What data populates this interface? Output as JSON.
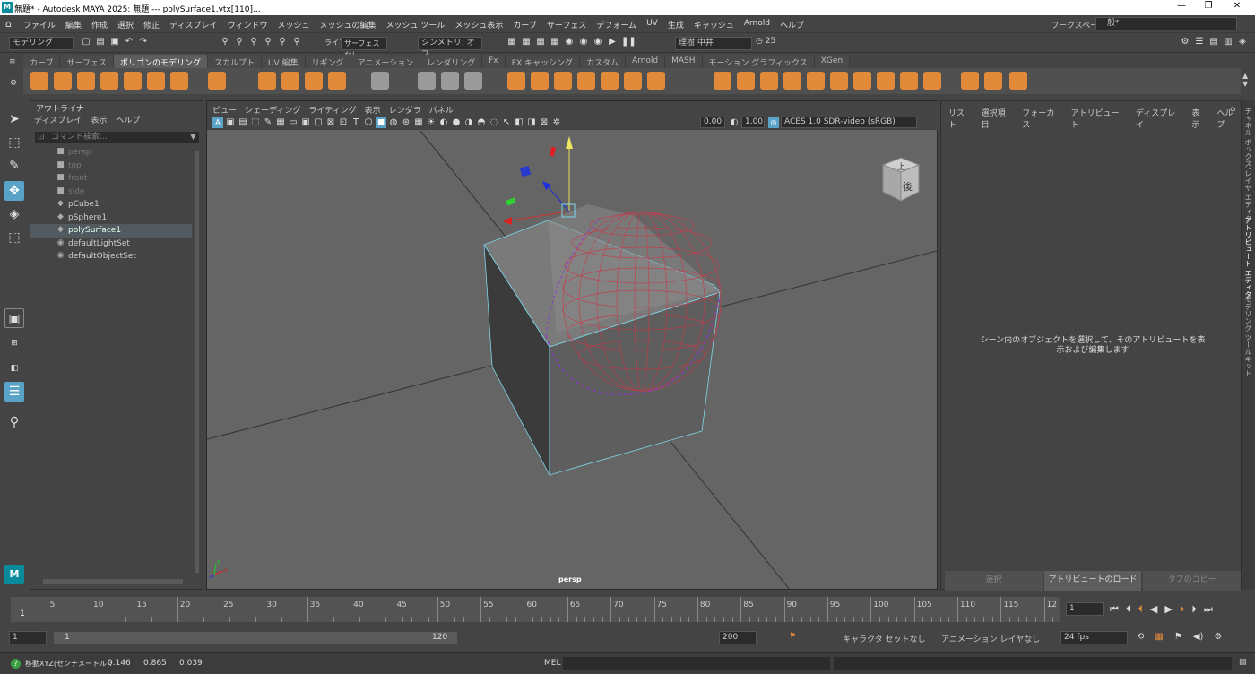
{
  "title": "無題* - Autodesk MAYA 2025: 無題   ---   polySurface1.vtx[110]...",
  "title_logo": "M",
  "window_controls": {
    "minimize": "—",
    "maximize": "❐",
    "close": "✕"
  },
  "menus": [
    "ファイル",
    "編集",
    "作成",
    "選択",
    "修正",
    "ディスプレイ",
    "ウィンドウ",
    "メッシュ",
    "メッシュの編集",
    "メッシュ ツール",
    "メッシュ表示",
    "カーブ",
    "サーフェス",
    "デフォーム",
    "UV",
    "生成",
    "キャッシュ",
    "Arnold",
    "ヘルプ"
  ],
  "workspace": {
    "label": "ワークスペース :",
    "value": "一般*"
  },
  "status": {
    "mode": "モデリング",
    "live_label": "ライブ",
    "live_value": "サーフェスなし",
    "symmetry": "シンメトリ: オフ",
    "user": "理樹 中井",
    "count": "25"
  },
  "shelf_tabs": [
    "カーブ",
    "サーフェス",
    "ポリゴンのモデリング",
    "スカルプト",
    "UV 編集",
    "リギング",
    "アニメーション",
    "レンダリング",
    "Fx",
    "FX キャッシング",
    "カスタム",
    "Arnold",
    "MASH",
    "モーション グラフィックス",
    "XGen"
  ],
  "shelf_active": "ポリゴンのモデリング",
  "outliner": {
    "title": "アウトライナ",
    "tabs": [
      "ディスプレイ",
      "表示",
      "ヘルプ"
    ],
    "search_placeholder": "コマンド検索...",
    "items": [
      {
        "label": "persp",
        "icon": "camera-icon",
        "dim": true
      },
      {
        "label": "top",
        "icon": "camera-icon",
        "dim": true
      },
      {
        "label": "front",
        "icon": "camera-icon",
        "dim": true
      },
      {
        "label": "side",
        "icon": "camera-icon",
        "dim": true
      },
      {
        "label": "pCube1",
        "icon": "mesh-icon",
        "dim": false
      },
      {
        "label": "pSphere1",
        "icon": "mesh-icon",
        "dim": false
      },
      {
        "label": "polySurface1",
        "icon": "mesh-icon",
        "dim": false,
        "selected": true
      },
      {
        "label": "defaultLightSet",
        "icon": "set-icon",
        "dim": false
      },
      {
        "label": "defaultObjectSet",
        "icon": "set-icon",
        "dim": false
      }
    ]
  },
  "viewport": {
    "menus": [
      "ビュー",
      "シェーディング",
      "ライティング",
      "表示",
      "レンダラ",
      "パネル"
    ],
    "field1": "0.00",
    "field2": "1.00",
    "colorspace": "ACES 1.0 SDR-video (sRGB)",
    "camera": "persp",
    "viewcube": {
      "top": "上",
      "face": "後"
    },
    "axis": {
      "x": "x",
      "y": "y",
      "z": "z"
    }
  },
  "attr": {
    "menus": [
      "リスト",
      "選択項目",
      "フォーカス",
      "アトリビュート",
      "ディスプレイ",
      "表示",
      "ヘルプ"
    ],
    "message": "シーン内のオブジェクトを選択して、そのアトリビュートを表示および編集します",
    "buttons": [
      "選択",
      "アトリビュートのロード",
      "タブのコピー"
    ]
  },
  "side_tabs": [
    "チャネル ボックス/レイヤ エディタ",
    "アトリビュート エディタ",
    "モデリング ツールキット"
  ],
  "timeline": {
    "ticks": [
      "5",
      "10",
      "15",
      "20",
      "25",
      "30",
      "35",
      "40",
      "45",
      "50",
      "55",
      "60",
      "65",
      "70",
      "75",
      "80",
      "85",
      "90",
      "95",
      "100",
      "105",
      "110",
      "115",
      "12"
    ],
    "start": "1",
    "current": "1"
  },
  "range": {
    "start": "1",
    "inner_start": "1",
    "inner_end": "120",
    "end": "200",
    "char_set": "キャラクタ セットなし",
    "anim_layer": "アニメーション レイヤなし",
    "fps": "24 fps"
  },
  "cmdline": {
    "help": "移動XYZ(センチメートル):",
    "x": "0.146",
    "y": "0.865",
    "z": "0.039",
    "lang": "MEL"
  },
  "toolbox_logo": "M",
  "colors": {
    "accent": "#5aa3c8",
    "orange": "#e08a3a",
    "selection": "#52595f",
    "sphere": "#c83a4a",
    "edge": "#7fd8ea"
  }
}
